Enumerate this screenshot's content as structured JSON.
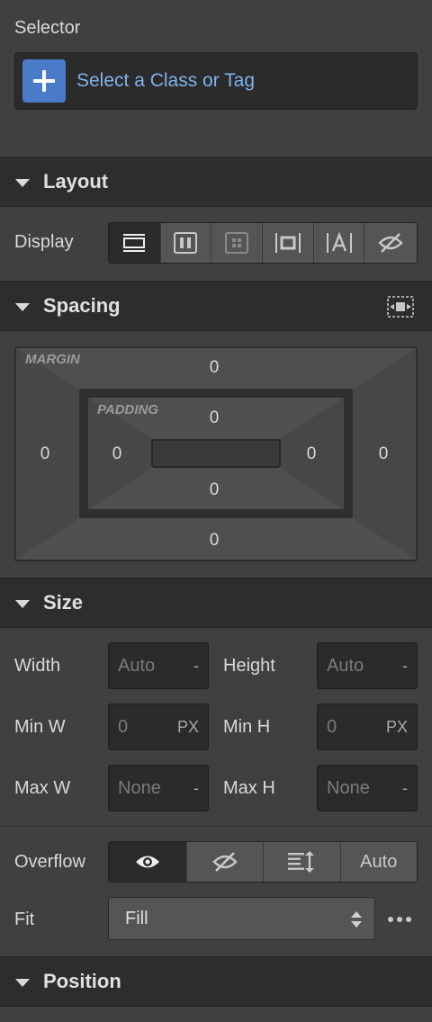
{
  "selector": {
    "title": "Selector",
    "placeholder": "Select a Class or Tag",
    "add_icon": "plus-icon"
  },
  "layout": {
    "title": "Layout",
    "display_label": "Display",
    "display_options": [
      {
        "name": "block",
        "icon": "display-block-icon",
        "active": true
      },
      {
        "name": "flex",
        "icon": "display-flex-icon",
        "active": false
      },
      {
        "name": "grid",
        "icon": "display-grid-icon",
        "active": false
      },
      {
        "name": "inline-block",
        "icon": "display-inline-block-icon",
        "active": false
      },
      {
        "name": "inline",
        "icon": "display-inline-icon",
        "active": false
      },
      {
        "name": "none",
        "icon": "display-none-icon",
        "active": false
      }
    ]
  },
  "spacing": {
    "title": "Spacing",
    "margin_label": "MARGIN",
    "padding_label": "PADDING",
    "margin": {
      "top": "0",
      "right": "0",
      "bottom": "0",
      "left": "0"
    },
    "padding": {
      "top": "0",
      "right": "0",
      "bottom": "0",
      "left": "0"
    }
  },
  "size": {
    "title": "Size",
    "width": {
      "label": "Width",
      "value": "Auto",
      "unit": "-"
    },
    "height": {
      "label": "Height",
      "value": "Auto",
      "unit": "-"
    },
    "min_w": {
      "label": "Min W",
      "value": "0",
      "unit": "PX"
    },
    "min_h": {
      "label": "Min H",
      "value": "0",
      "unit": "PX"
    },
    "max_w": {
      "label": "Max W",
      "value": "None",
      "unit": "-"
    },
    "max_h": {
      "label": "Max H",
      "value": "None",
      "unit": "-"
    },
    "overflow_label": "Overflow",
    "overflow_auto": "Auto",
    "fit_label": "Fit",
    "fit_value": "Fill",
    "more_icon": "more-dots-icon"
  },
  "position": {
    "title": "Position"
  }
}
